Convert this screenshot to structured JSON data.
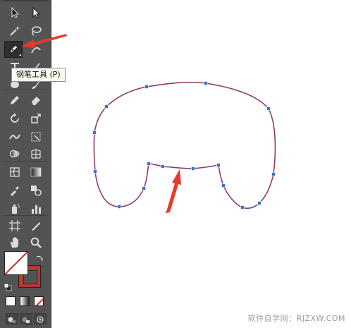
{
  "toolbar": {
    "tools": [
      {
        "name": "selection-tool",
        "icon": "arrow-icon"
      },
      {
        "name": "direct-selection-tool",
        "icon": "white-arrow-icon"
      },
      {
        "name": "magic-wand-tool",
        "icon": "magic-wand-icon"
      },
      {
        "name": "lasso-tool",
        "icon": "lasso-icon"
      },
      {
        "name": "pen-tool",
        "icon": "pen-icon",
        "active": true
      },
      {
        "name": "curvature-tool",
        "icon": "curvature-icon"
      },
      {
        "name": "type-tool",
        "icon": "type-icon"
      },
      {
        "name": "line-tool",
        "icon": "line-icon"
      }
    ],
    "tooltip": "钢笔工具 (P)"
  },
  "colors": {
    "toolbar_bg": "#535353",
    "path_stroke": "#8e3b6b",
    "anchor": "#3d6fe0",
    "arrow_red": "#e8392c",
    "stroke_swatch": "#b43a2e"
  },
  "watermark": "软件自学网：RJZXW.COM"
}
